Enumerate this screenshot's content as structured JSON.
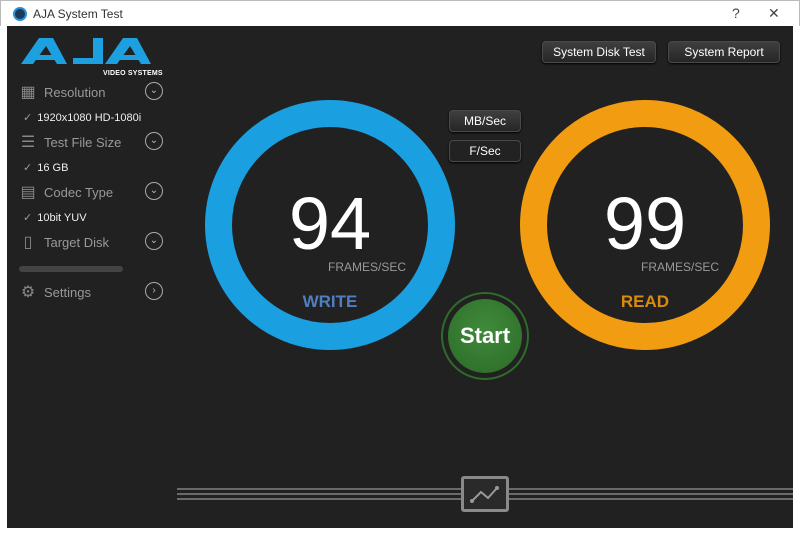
{
  "window": {
    "title": "AJA System Test",
    "help": "?",
    "close": "✕"
  },
  "logo": {
    "text": "AJA",
    "subtitle": "VIDEO SYSTEMS"
  },
  "sidebar": {
    "items": [
      {
        "label": "Resolution",
        "icon": "chip-icon",
        "value": "1920x1080 HD-1080i"
      },
      {
        "label": "Test File Size",
        "icon": "layers-icon",
        "value": "16 GB"
      },
      {
        "label": "Codec Type",
        "icon": "grid-icon",
        "value": "10bit YUV"
      },
      {
        "label": "Target Disk",
        "icon": "disk-icon"
      },
      {
        "label": "Settings",
        "icon": "gear-icon"
      }
    ],
    "check": "✓"
  },
  "toolbar": {
    "disk_test": "System Disk Test",
    "report": "System Report"
  },
  "units": {
    "mb": "MB/Sec",
    "f": "F/Sec"
  },
  "write": {
    "value": "94",
    "unit": "FRAMES/SEC",
    "label": "WRITE",
    "color": "#1a9fe0",
    "label_color": "#4f7fc0"
  },
  "read": {
    "value": "99",
    "unit": "FRAMES/SEC",
    "label": "READ",
    "color": "#f29c11",
    "label_color": "#d98a12"
  },
  "start": {
    "label": "Start",
    "color": "#3a7f35"
  }
}
